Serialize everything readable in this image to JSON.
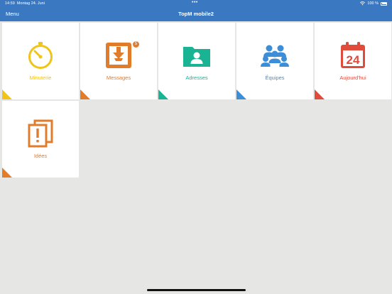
{
  "status_bar": {
    "time": "14:59",
    "date": "Montag 24. Juni",
    "dots": "•••",
    "battery": "100 %"
  },
  "nav": {
    "menu_label": "Menu",
    "title": "TopM mobile2"
  },
  "tiles": [
    {
      "label": "Minuterie",
      "icon": "stopwatch-icon",
      "color": "#f0c419"
    },
    {
      "label": "Messages",
      "icon": "inbox-download-icon",
      "color": "#e07c2a",
      "badge": "5"
    },
    {
      "label": "Adresses",
      "icon": "contact-folder-icon",
      "color": "#1ab394"
    },
    {
      "label": "Équipes",
      "icon": "group-icon",
      "color": "#3c8fd6"
    },
    {
      "label": "Aujourd'hui",
      "icon": "calendar-icon",
      "color": "#e04c3c",
      "calendar_day": "24"
    },
    {
      "label": "Idées",
      "icon": "idea-documents-icon",
      "color": "#e07c2a"
    }
  ],
  "colors": {
    "nav_background": "#3a78c2",
    "page_background": "#e6e6e4"
  }
}
